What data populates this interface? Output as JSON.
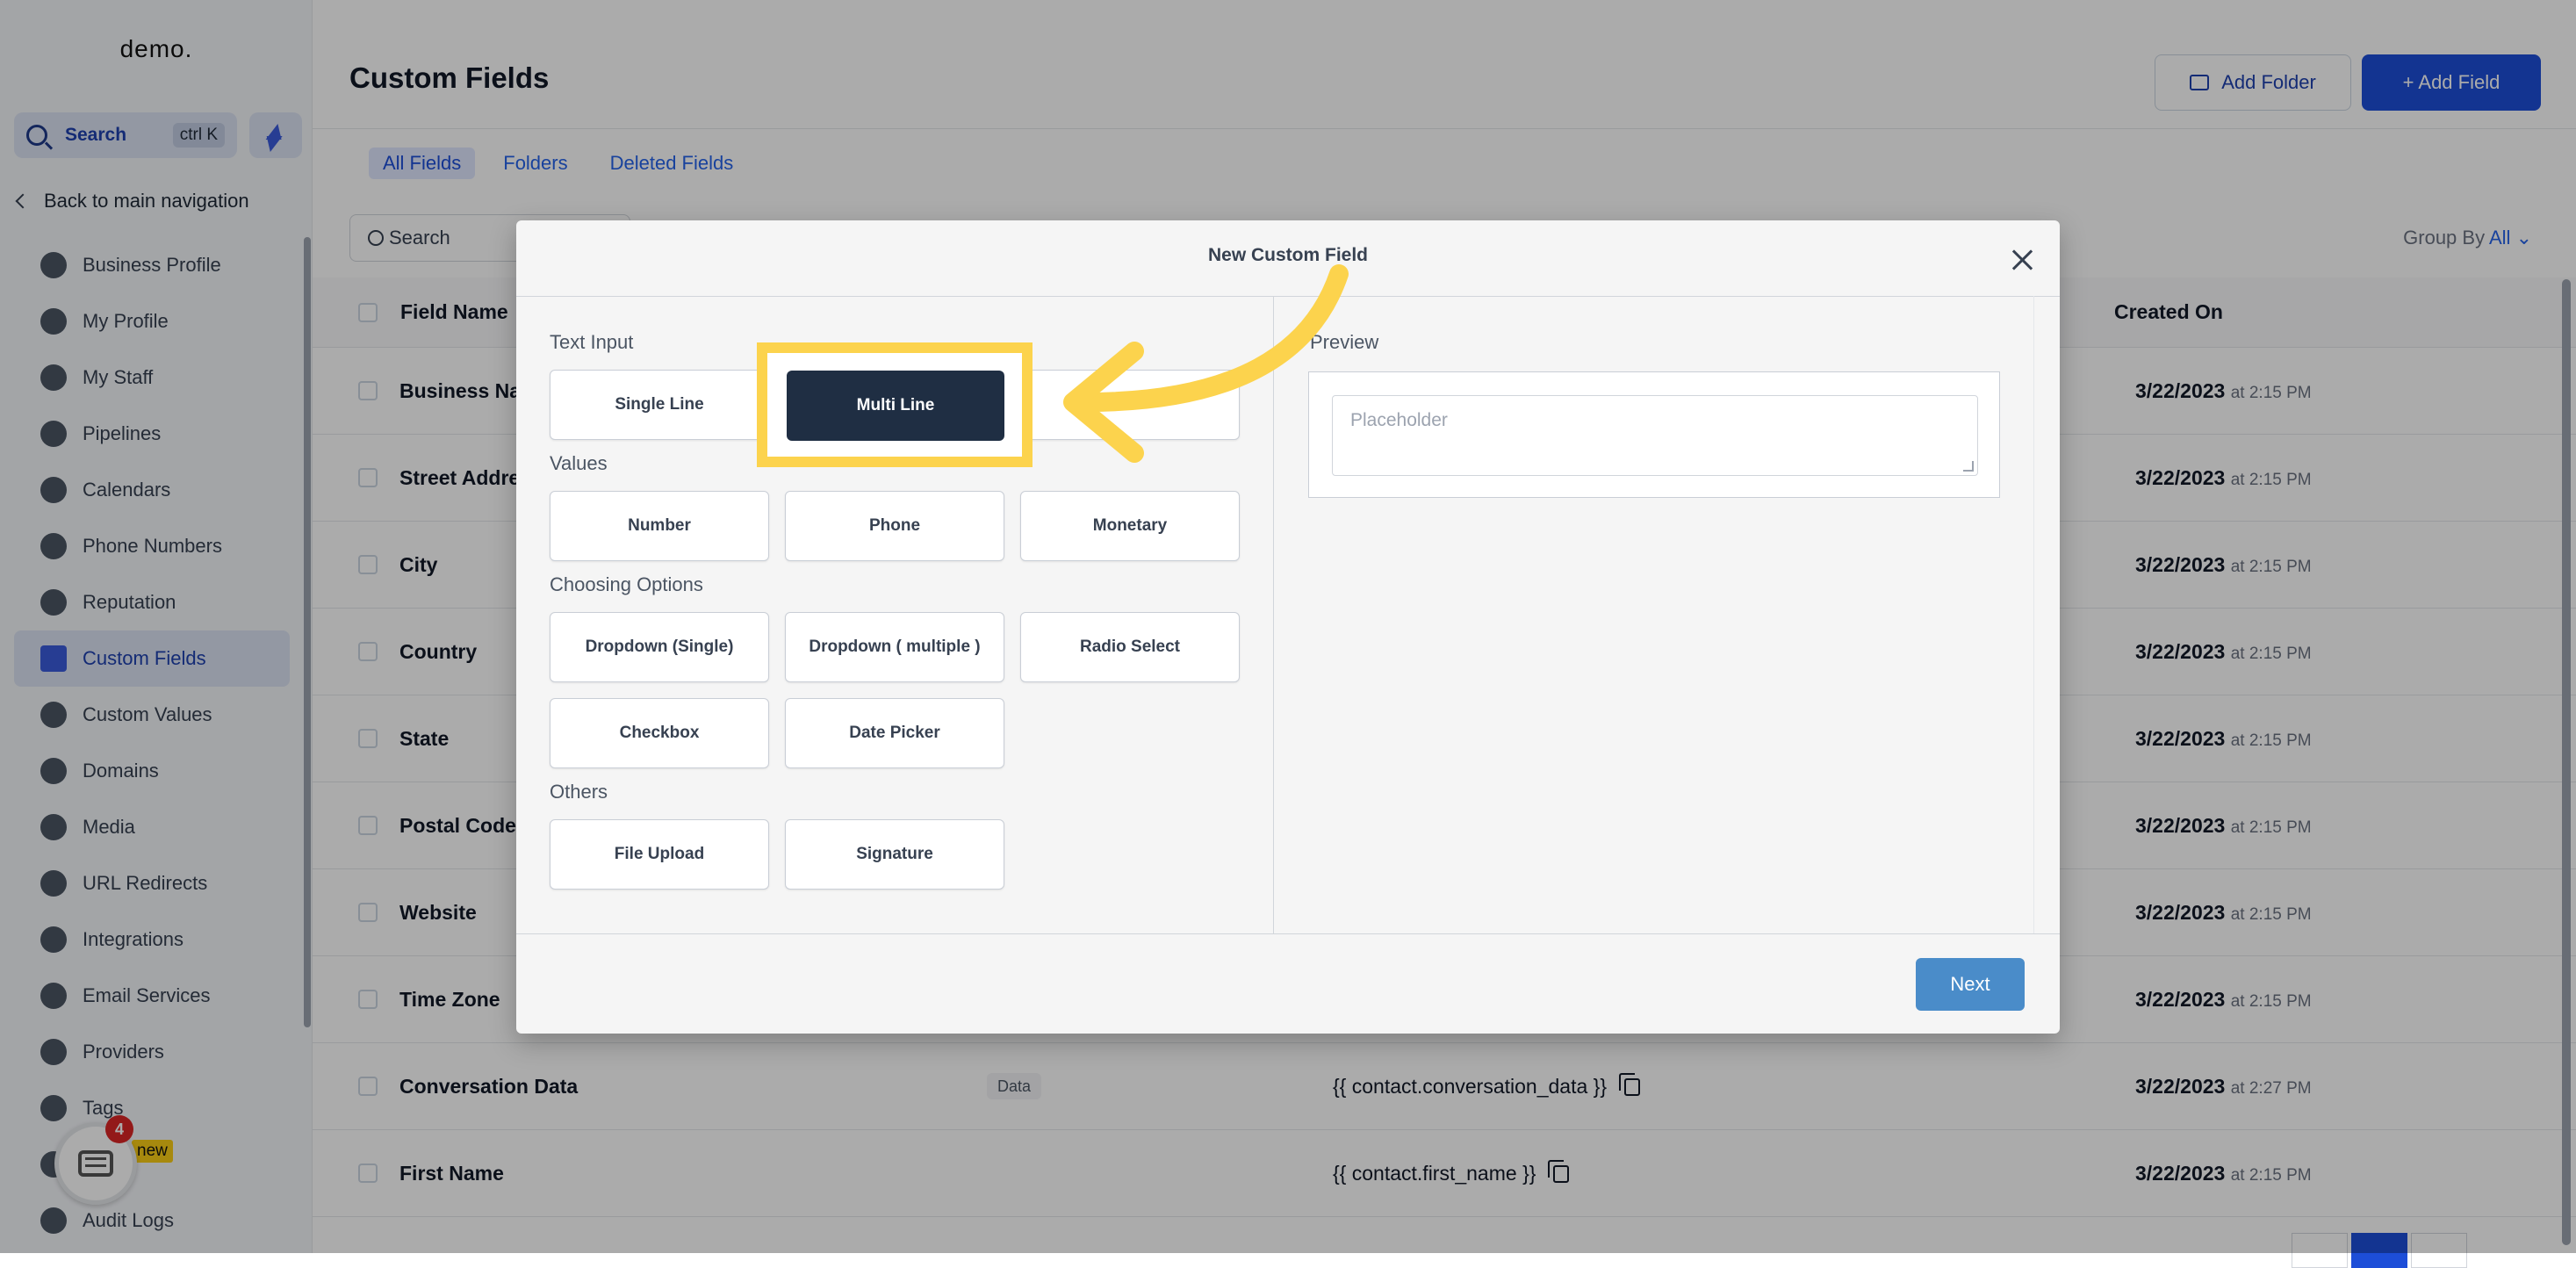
{
  "sidebar": {
    "logo": "demo.",
    "search_label": "Search",
    "search_shortcut": "ctrl K",
    "back_label": "Back to main navigation",
    "items": [
      {
        "label": "Business Profile"
      },
      {
        "label": "My Profile"
      },
      {
        "label": "My Staff"
      },
      {
        "label": "Pipelines"
      },
      {
        "label": "Calendars"
      },
      {
        "label": "Phone Numbers"
      },
      {
        "label": "Reputation"
      },
      {
        "label": "Custom Fields",
        "active": true
      },
      {
        "label": "Custom Values"
      },
      {
        "label": "Domains"
      },
      {
        "label": "Media"
      },
      {
        "label": "URL Redirects"
      },
      {
        "label": "Integrations"
      },
      {
        "label": "Email Services"
      },
      {
        "label": "Providers"
      },
      {
        "label": "Tags"
      },
      {
        "label": ""
      },
      {
        "label": "Audit Logs"
      }
    ],
    "new_badge": "new",
    "chat_count": "4"
  },
  "header": {
    "title": "Custom Fields",
    "add_folder_label": "Add Folder",
    "add_field_label": "+ Add Field"
  },
  "tabs": [
    {
      "label": "All Fields",
      "active": true
    },
    {
      "label": "Folders"
    },
    {
      "label": "Deleted Fields"
    }
  ],
  "table": {
    "search_placeholder": "Search",
    "group_by_label": "Group By",
    "group_by_value": "All",
    "columns": {
      "name": "Field Name",
      "created": "Created On"
    },
    "rows": [
      {
        "name": "Business Name",
        "date": "3/22/2023",
        "time": "at 2:15 PM"
      },
      {
        "name": "Street Address",
        "date": "3/22/2023",
        "time": "at 2:15 PM"
      },
      {
        "name": "City",
        "date": "3/22/2023",
        "time": "at 2:15 PM"
      },
      {
        "name": "Country",
        "date": "3/22/2023",
        "time": "at 2:15 PM"
      },
      {
        "name": "State",
        "date": "3/22/2023",
        "time": "at 2:15 PM"
      },
      {
        "name": "Postal Code",
        "date": "3/22/2023",
        "time": "at 2:15 PM"
      },
      {
        "name": "Website",
        "date": "3/22/2023",
        "time": "at 2:15 PM"
      },
      {
        "name": "Time Zone",
        "date": "3/22/2023",
        "time": "at 2:15 PM"
      },
      {
        "name": "Conversation Data",
        "tag": "Data",
        "key": "{{ contact.conversation_data }}",
        "date": "3/22/2023",
        "time": "at 2:27 PM"
      },
      {
        "name": "First Name",
        "key": "{{ contact.first_name }}",
        "date": "3/22/2023",
        "time": "at 2:15 PM"
      }
    ]
  },
  "modal": {
    "title": "New Custom Field",
    "sections": {
      "text_input": "Text Input",
      "values": "Values",
      "choosing_options": "Choosing Options",
      "others": "Others"
    },
    "types": {
      "single_line": "Single Line",
      "multi_line": "Multi Line",
      "number": "Number",
      "phone": "Phone",
      "monetary": "Monetary",
      "dropdown_single": "Dropdown (Single)",
      "dropdown_multiple": "Dropdown ( multiple )",
      "radio_select": "Radio Select",
      "checkbox": "Checkbox",
      "date_picker": "Date Picker",
      "file_upload": "File Upload",
      "signature": "Signature"
    },
    "preview_label": "Preview",
    "preview_placeholder": "Placeholder",
    "next_label": "Next"
  },
  "colors": {
    "accent": "#1d4ed8",
    "highlight": "#fcd34d",
    "selected_button": "#1f2e43",
    "next_button": "#4a8cc9"
  }
}
